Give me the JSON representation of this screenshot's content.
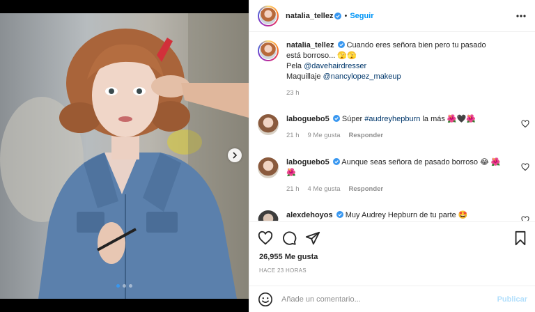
{
  "post": {
    "author": "natalia_tellez",
    "follow_label": "Seguir",
    "separator": "•",
    "caption": {
      "text": "Cuando eres señora bien pero tu pasado está borroso... ",
      "emoji": "🫣🫣",
      "line2_prefix": "Pela ",
      "line2_mention": "@davehairdresser",
      "line3_prefix": "Maquillaje ",
      "line3_mention": "@nancylopez_makeup",
      "time": "23 h"
    },
    "comments": [
      {
        "user": "laboguebo5",
        "text_prefix": "Súper ",
        "hashtag": "#audreyhepburn",
        "text_suffix": " la más 🌺🖤🌺",
        "time": "21 h",
        "likes": "9 Me gusta",
        "reply_label": "Responder"
      },
      {
        "user": "laboguebo5",
        "text": "Aunque seas señora de pasado borroso 😂 🌺 🌺",
        "time": "21 h",
        "likes": "4 Me gusta",
        "reply_label": "Responder"
      },
      {
        "user": "alexdehoyos",
        "text": "Muy Audrey Hepburn de tu parte 🤩"
      }
    ],
    "likes_count": "26,955 Me gusta",
    "posted_ago": "HACE 23 HORAS",
    "comment_placeholder": "Añade un comentario...",
    "publish_label": "Publicar",
    "carousel": {
      "total": 3,
      "active": 0
    }
  },
  "icons": {
    "verified": "verified-badge-icon",
    "more": "more-options-icon",
    "like": "heart-icon",
    "comment": "comment-icon",
    "share": "send-icon",
    "save": "bookmark-icon",
    "emoji": "smiley-icon",
    "next": "chevron-right-icon"
  },
  "colors": {
    "accent": "#0095f6",
    "verified": "#3897f0",
    "muted": "#8e8e8e",
    "mention": "#00376b"
  }
}
